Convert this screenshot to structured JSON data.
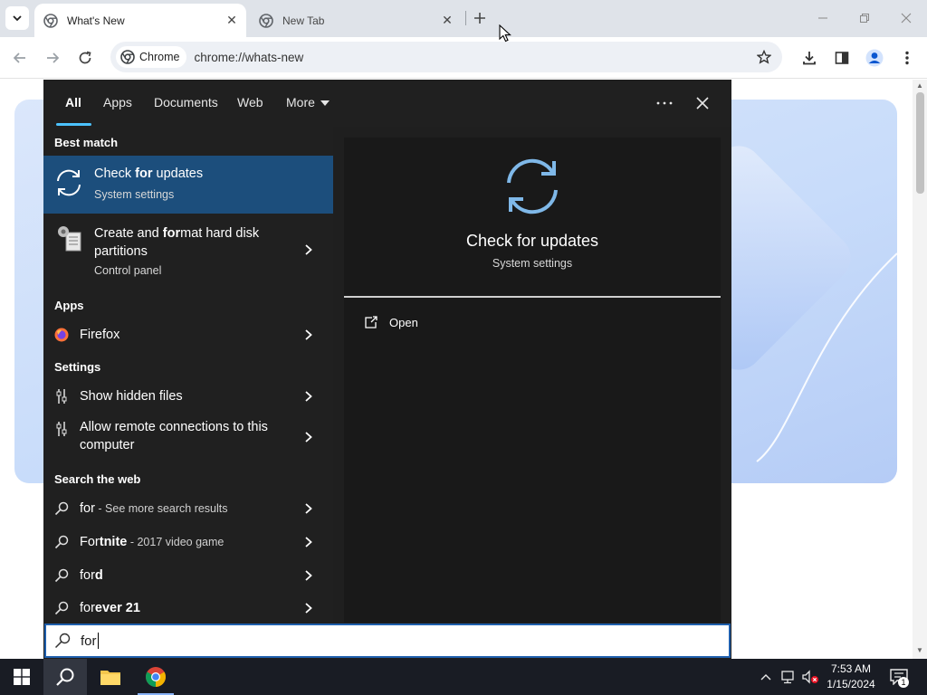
{
  "browser": {
    "tabs": [
      {
        "title": "What's New",
        "active": true
      },
      {
        "title": "New Tab",
        "active": false
      }
    ],
    "omnibox": {
      "chip_label": "Chrome",
      "url": "chrome://whats-new"
    }
  },
  "search_panel": {
    "filter_tabs": [
      "All",
      "Apps",
      "Documents",
      "Web",
      "More"
    ],
    "sections": {
      "best_match": "Best match",
      "apps": "Apps",
      "settings": "Settings",
      "search_web": "Search the web"
    },
    "best_match": [
      {
        "title_pre": "Check ",
        "title_bold": "for",
        "title_post": " updates",
        "subtitle": "System settings"
      },
      {
        "title_line1_pre": "Create and ",
        "title_line1_bold": "for",
        "title_line1_post": "mat hard disk",
        "title_line2": "partitions",
        "subtitle": "Control panel"
      }
    ],
    "apps": [
      {
        "title": "Firefox"
      }
    ],
    "settings": [
      {
        "title": "Show hidden files"
      },
      {
        "title_line1": "Allow remote connections to this",
        "title_line2": "computer"
      }
    ],
    "web": [
      {
        "term": "for",
        "extra": " - See more search results"
      },
      {
        "term_pre": "For",
        "term_bold": "tnite",
        "extra": " - 2017 video game"
      },
      {
        "term": "for",
        "term_bold": "d"
      },
      {
        "term": "for",
        "term_bold": "ever 21"
      }
    ],
    "preview": {
      "title": "Check for updates",
      "subtitle": "System settings",
      "action": "Open"
    },
    "query": "for"
  },
  "taskbar": {
    "time": "7:53 AM",
    "date": "1/15/2024",
    "notification_count": "1"
  }
}
